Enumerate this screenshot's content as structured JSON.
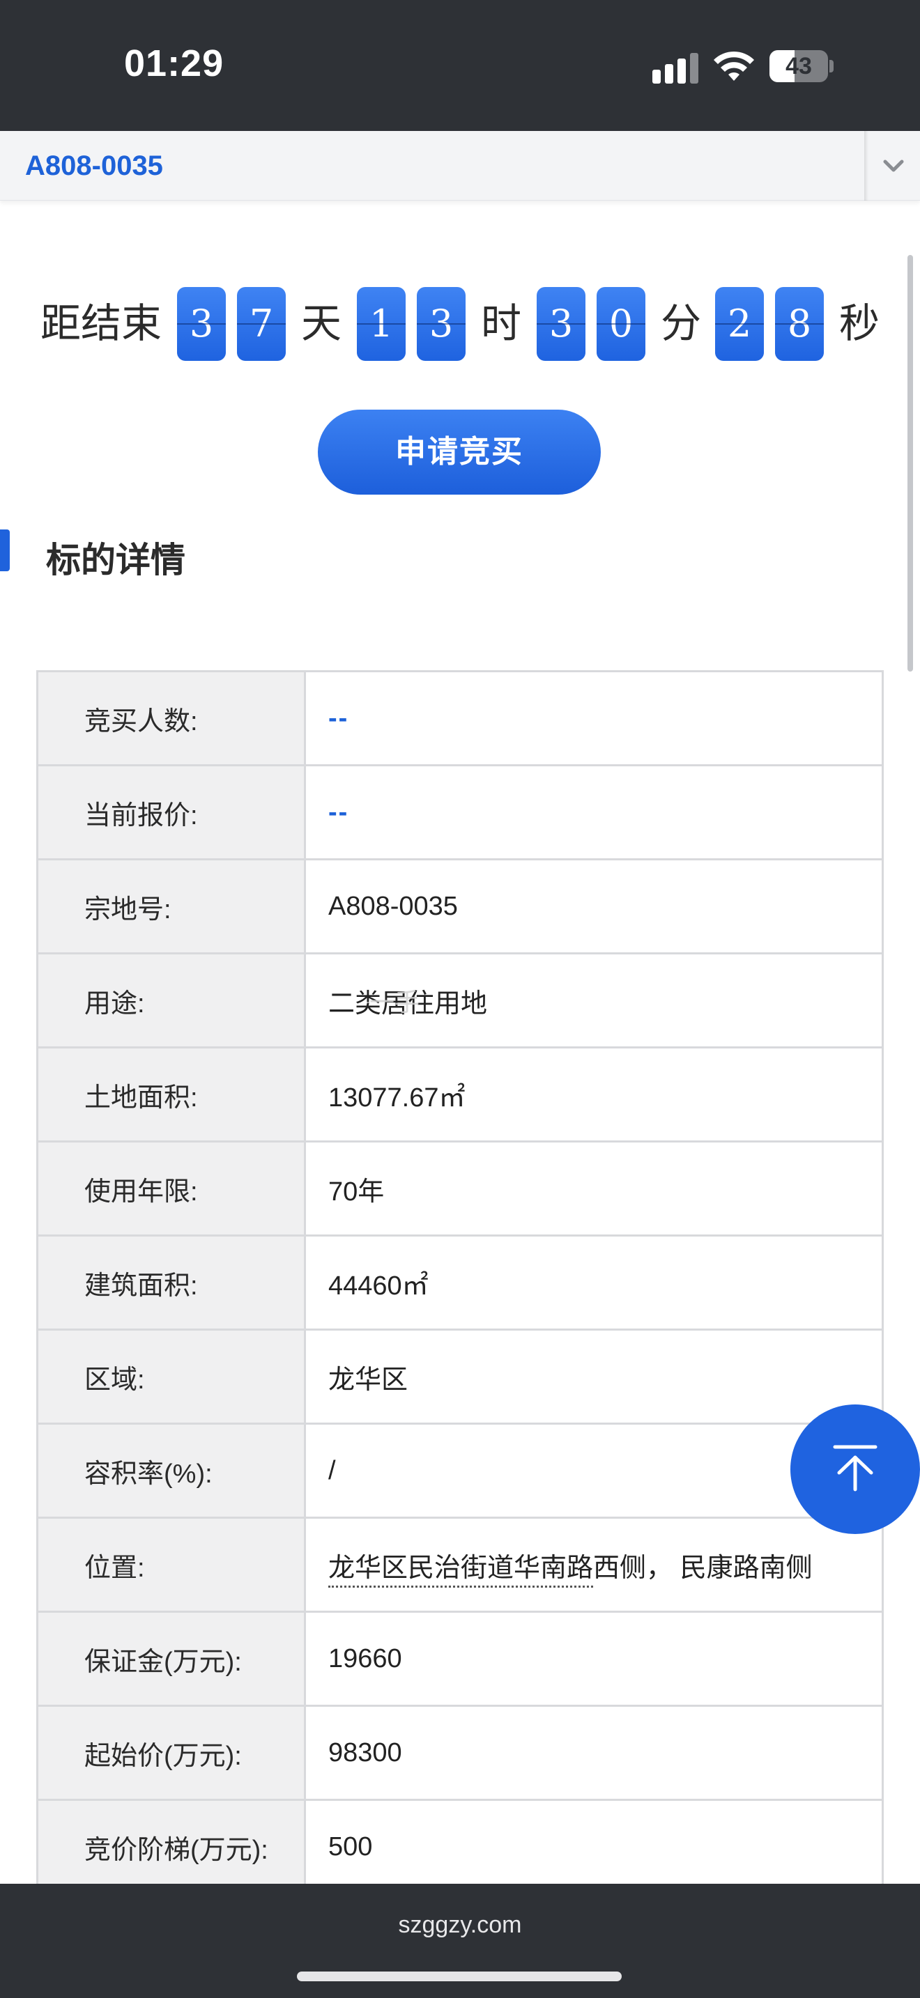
{
  "status_bar": {
    "time": "01:29",
    "battery_level": "43",
    "signal_icon": "cellular-signal-icon",
    "wifi_icon": "wifi-icon",
    "battery_icon": "battery-icon"
  },
  "select_bar": {
    "value": "A808-0035",
    "arrow_icon": "chevron-down-icon"
  },
  "countdown": {
    "prefix": "距结束",
    "days": [
      "3",
      "7"
    ],
    "days_unit": "天",
    "hours": [
      "1",
      "3"
    ],
    "hours_unit": "时",
    "minutes": [
      "3",
      "0"
    ],
    "minutes_unit": "分",
    "seconds": [
      "2",
      "8"
    ],
    "seconds_unit": "秒"
  },
  "apply_button": {
    "label": "申请竞买"
  },
  "section": {
    "title": "标的详情"
  },
  "details": [
    {
      "label": "竞买人数:",
      "value": "--"
    },
    {
      "label": "当前报价:",
      "value": "--"
    },
    {
      "label": "宗地号:",
      "value": "A808-0035"
    },
    {
      "label": "用途:",
      "value": "二类居住用地"
    },
    {
      "label": "土地面积:",
      "value": "13077.67㎡"
    },
    {
      "label": "使用年限:",
      "value": "70年"
    },
    {
      "label": "建筑面积:",
      "value": "44460㎡"
    },
    {
      "label": "区域:",
      "value": "龙华区"
    },
    {
      "label": "容积率(%):",
      "value": "/"
    },
    {
      "label": "位置:",
      "value_part1": "龙华区民治街道华南路",
      "value_part2": "西侧， 民康路南侧"
    },
    {
      "label": "保证金(万元):",
      "value": "19660"
    },
    {
      "label": "起始价(万元):",
      "value": "98300"
    },
    {
      "label": "竞价阶梯(万元):",
      "value": "500"
    }
  ],
  "watermark": {
    "text": "一手"
  },
  "back_to_top": {
    "icon": "arrow-up-to-top-icon"
  },
  "browser": {
    "domain": "szggzy.com"
  },
  "colors": {
    "accent": "#1f63e0",
    "status_bar_bg": "#2e3136",
    "label_cell_bg": "#f0f0f1",
    "border": "#d8d9dc"
  }
}
